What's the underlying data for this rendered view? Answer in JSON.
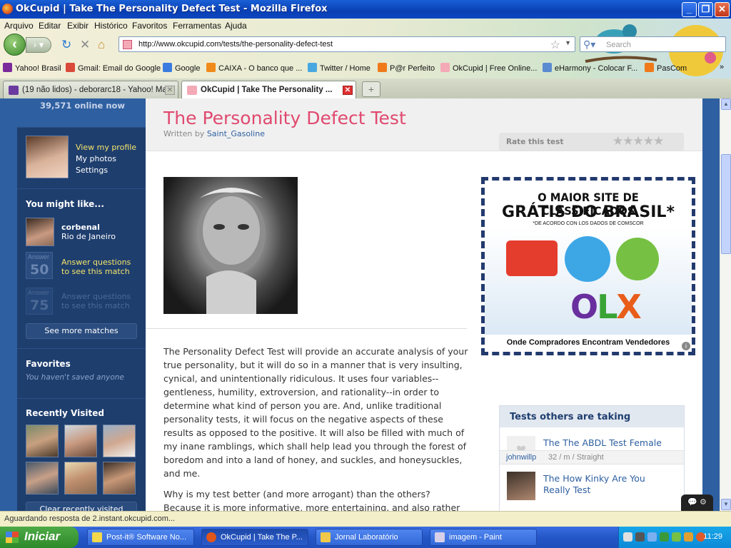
{
  "window": {
    "title": "OkCupid | Take The Personality Defect Test - Mozilla Firefox"
  },
  "menu": [
    "Arquivo",
    "Editar",
    "Exibir",
    "Histórico",
    "Favoritos",
    "Ferramentas",
    "Ajuda"
  ],
  "nav": {
    "url": "http://www.okcupid.com/tests/the-personality-defect-test",
    "search_placeholder": "Search"
  },
  "bookmarks": [
    "Yahoo! Brasil",
    "Gmail: Email do Google",
    "Google",
    "CAIXA - O banco que ...",
    "Twitter / Home",
    "P@r Perfeito",
    "OkCupid | Free Online...",
    "eHarmony - Colocar F...",
    "PasCom"
  ],
  "tabs": [
    {
      "label": "(19 não lidos) - deborarc18 - Yahoo! Mail"
    },
    {
      "label": "OkCupid | Take The Personality ..."
    }
  ],
  "sidebar": {
    "online": "39,571 online now",
    "profile_links": [
      "View my profile",
      "My photos",
      "Settings"
    ],
    "you_might_like": "You might like...",
    "match_user": "corbenal",
    "match_location": "Rio de Janeiro",
    "answer_label": "Answer",
    "answer_1": "50",
    "answer_2": "75",
    "answer_cta_1": "Answer questions to see this match",
    "answer_cta_2": "Answer questions to see this match",
    "see_more": "See more matches",
    "favorites": "Favorites",
    "favorites_empty": "You haven't saved anyone",
    "recently_visited": "Recently Visited",
    "clear_recent": "Clear recently visited"
  },
  "test": {
    "title": "The Personality Defect Test",
    "written_by": "Written by",
    "author": "Saint_Gasoline",
    "rate_label": "Rate this test",
    "stars": "★★★★★",
    "description_1": "The Personality Defect Test will provide an accurate analysis of your true personality, but it will do so in a manner that is very insulting, cynical, and unintentionally ridiculous. It uses four variables--gentleness, humility, extroversion, and rationality--in order to determine what kind of person you are. And, unlike traditional personality tests, it will focus on the negative aspects of these results as opposed to the positive. It will also be filled with much of my inane ramblings, which shall help lead you through the forest of boredom and into a land of honey, and suckles, and honeysuckles, and me.",
    "description_2": "Why is my test better (and more arrogant) than the others? Because it is more informative, more entertaining, and also rather"
  },
  "ad": {
    "line1": "O MAIOR SITE DE CLASSIFICADOS",
    "line2": "GRÁTIS DO BRASIL*",
    "line3": "*DE ACORDO CON LOS DADOS DE COMSCOR",
    "brand_o": "O",
    "brand_l": "L",
    "brand_x": "X",
    "tagline": "Onde Compradores Encontram Vendedores"
  },
  "others": {
    "header": "Tests others are taking",
    "item1": "The The ABDL Test Female version Test",
    "item1_user": "johnwillp",
    "item1_meta": "32 / m / Straight",
    "item2": "The How Kinky Are You Really Test"
  },
  "status": "Aguardando resposta de 2.instant.okcupid.com...",
  "taskbar": {
    "start": "Iniciar",
    "tasks": [
      "Post-it® Software No...",
      "OkCupid | Take The P...",
      "Jornal Laboratório",
      "imagem - Paint"
    ],
    "clock": "11:29"
  },
  "colors": {
    "accent": "#e0496f",
    "sidebar": "#1e3e6e",
    "page_bg": "#2e5fa0",
    "link": "#2e5fa0"
  }
}
